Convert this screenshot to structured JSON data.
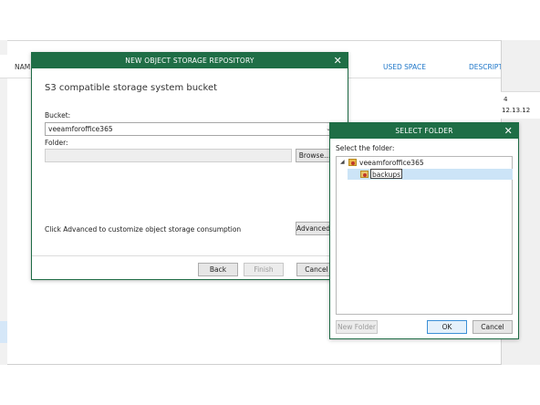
{
  "background": {
    "columns": {
      "name": "NAM",
      "used_space": "USED SPACE",
      "description": "DESCRIPT"
    },
    "right_panel": {
      "fragment1": "4",
      "fragment2": "12.13.12"
    }
  },
  "repo_dialog": {
    "title": "NEW OBJECT STORAGE REPOSITORY",
    "heading": "S3 compatible storage system bucket",
    "bucket_label": "Bucket:",
    "bucket_value": "veeamforoffice365",
    "folder_label": "Folder:",
    "folder_value": "",
    "browse_label": "Browse...",
    "advanced_hint": "Click Advanced to customize object storage consumption",
    "advanced_label": "Advanced...",
    "back_label": "Back",
    "finish_label": "Finish",
    "cancel_label": "Cancel"
  },
  "folder_dialog": {
    "title": "SELECT FOLDER",
    "prompt": "Select the folder:",
    "tree": {
      "root": "veeamforoffice365",
      "child": "backups"
    },
    "new_folder_label": "New Folder",
    "ok_label": "OK",
    "cancel_label": "Cancel"
  },
  "colors": {
    "titlebar": "#1f6e46",
    "link": "#1f77c9",
    "selection": "#cce4f7"
  }
}
